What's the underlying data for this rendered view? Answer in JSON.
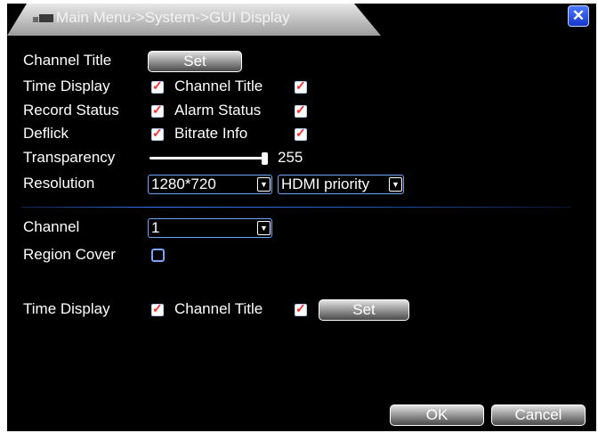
{
  "window": {
    "title": "Main Menu->System->GUI Display",
    "close_icon": "close-icon"
  },
  "section1": {
    "channel_title_label": "Channel Title",
    "set_label": "Set",
    "time_display_label": "Time Display",
    "time_display_checked": true,
    "channel_title_check_label": "Channel Title",
    "channel_title_checked": true,
    "record_status_label": "Record Status",
    "record_status_checked": true,
    "alarm_status_label": "Alarm Status",
    "alarm_status_checked": true,
    "deflick_label": "Deflick",
    "deflick_checked": true,
    "bitrate_info_label": "Bitrate Info",
    "bitrate_info_checked": true,
    "transparency_label": "Transparency",
    "transparency_value": "255",
    "resolution_label": "Resolution",
    "resolution_value": "1280*720",
    "output_priority_value": "HDMI priority"
  },
  "section2": {
    "channel_label": "Channel",
    "channel_value": "1",
    "region_cover_label": "Region Cover",
    "region_cover_checked": false,
    "time_display_label": "Time Display",
    "time_display_checked": true,
    "channel_title_label": "Channel Title",
    "channel_title_checked": true,
    "set_label": "Set"
  },
  "footer": {
    "ok_label": "OK",
    "cancel_label": "Cancel"
  },
  "colors": {
    "accent_border": "#6aa6ff",
    "check_mark": "#ff2a2a"
  }
}
